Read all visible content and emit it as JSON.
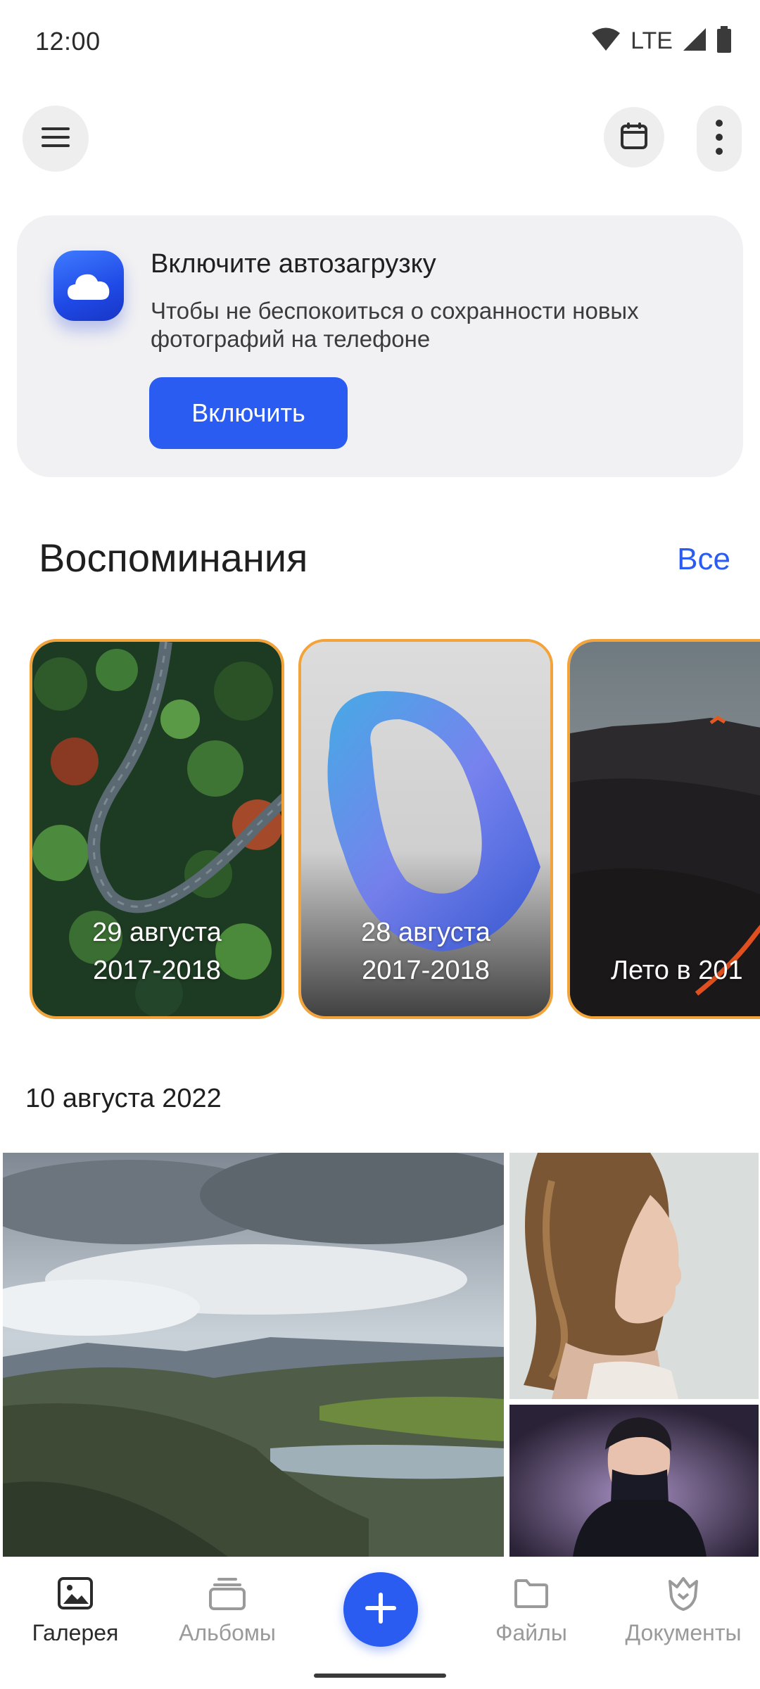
{
  "status_bar": {
    "time": "12:00",
    "network": "LTE",
    "icons": [
      "wifi-icon",
      "signal-icon",
      "battery-icon"
    ]
  },
  "toolbar": {
    "icons": [
      "menu-icon",
      "calendar-icon",
      "more-vert-icon"
    ]
  },
  "autoload_banner": {
    "icon": "cloud-icon",
    "title": "Включите автозагрузку",
    "text": "Чтобы не беспокоиться о сохранности новых фотографий на телефоне",
    "button_label": "Включить"
  },
  "memories": {
    "title": "Воспоминания",
    "all_link": "Все",
    "cards": [
      {
        "line1": "29 августа",
        "line2": "2017-2018"
      },
      {
        "line1": "28 августа",
        "line2": "2017-2018"
      },
      {
        "line1": "Лето в 201",
        "line2": ""
      }
    ]
  },
  "gallery": {
    "date": "10 августа 2022"
  },
  "bottom_nav": {
    "items": [
      {
        "label": "Галерея",
        "icon": "gallery-icon",
        "active": true
      },
      {
        "label": "Альбомы",
        "icon": "albums-icon",
        "active": false
      },
      {
        "label": "",
        "icon": "plus-icon",
        "active": false
      },
      {
        "label": "Файлы",
        "icon": "folder-icon",
        "active": false
      },
      {
        "label": "Документы",
        "icon": "documents-icon",
        "active": false
      }
    ]
  },
  "colors": {
    "accent": "#2b5cf2",
    "memory_border": "#f2a33a",
    "banner_bg": "#f1f1f3"
  }
}
